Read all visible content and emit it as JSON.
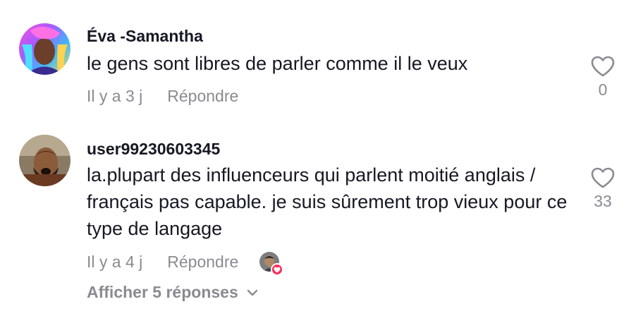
{
  "comments": [
    {
      "username": "Éva -Samantha",
      "text": "le gens sont libres de parler comme il le veux",
      "time": "Il y a 3 j",
      "reply_label": "Répondre",
      "like_count": "0",
      "avatar_icon": "rainbow-hair-avatar"
    },
    {
      "username": "user99230603345",
      "text": "la.plupart des influenceurs qui parlent moitié anglais / français pas capable. je suis sûrement trop vieux pour ce type de langage",
      "time": "Il y a 4 j",
      "reply_label": "Répondre",
      "like_count": "33",
      "avatar_icon": "warrior-avatar",
      "creator_liked_icon": "creator-liked-heart-icon"
    }
  ],
  "show_replies": {
    "label": "Afficher 5 réponses",
    "icon": "chevron-down-icon"
  },
  "colors": {
    "text": "#161823",
    "muted": "#8a8b91",
    "like_badge": "#fe2c55"
  }
}
